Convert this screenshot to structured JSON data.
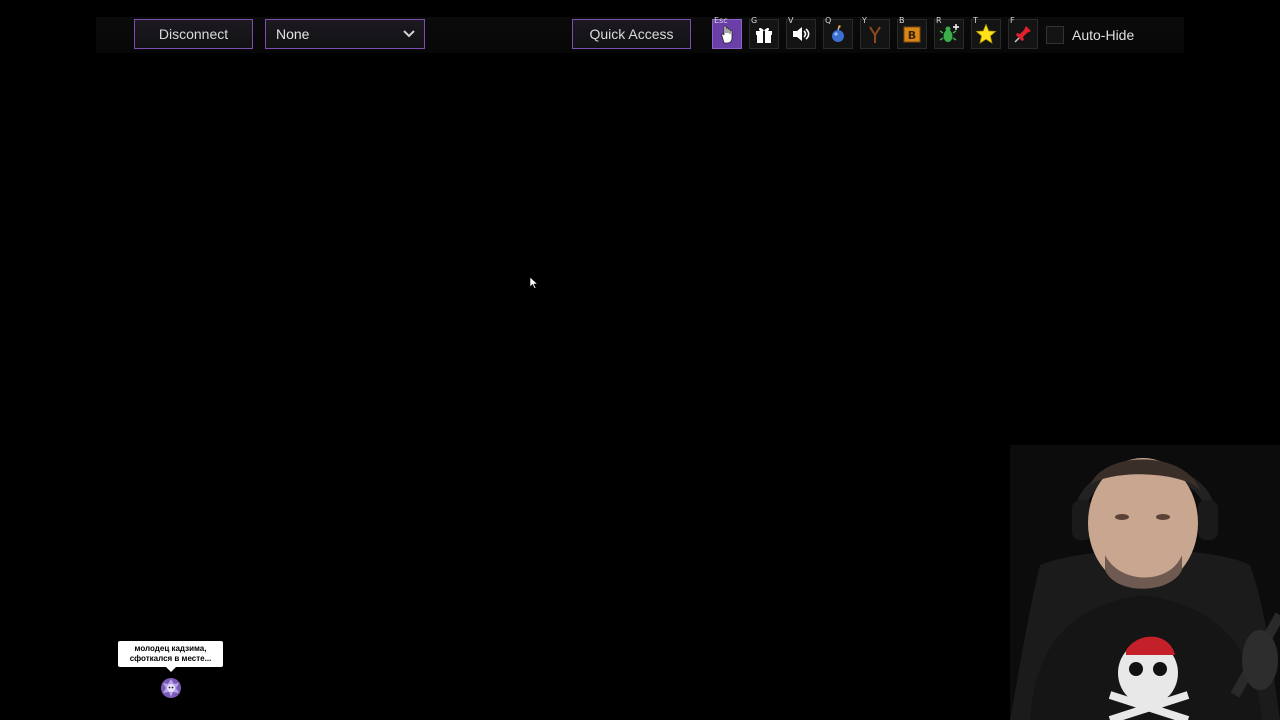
{
  "toolbar": {
    "disconnect_label": "Disconnect",
    "select_value": "None",
    "quick_access_label": "Quick Access",
    "tools": [
      {
        "key": "Esc",
        "icon": "hand-pointer-icon",
        "active": true
      },
      {
        "key": "G",
        "icon": "gift-icon",
        "active": false
      },
      {
        "key": "V",
        "icon": "speaker-icon",
        "active": false
      },
      {
        "key": "Q",
        "icon": "bomb-icon",
        "active": false
      },
      {
        "key": "Y",
        "icon": "slingshot-icon",
        "active": false
      },
      {
        "key": "B",
        "icon": "b-block-icon",
        "active": false
      },
      {
        "key": "R",
        "icon": "green-bug-icon",
        "active": false
      },
      {
        "key": "T",
        "icon": "star-icon",
        "active": false
      },
      {
        "key": "F",
        "icon": "pin-icon",
        "active": false
      }
    ],
    "autohide_label": "Auto-Hide",
    "autohide_checked": false
  },
  "chat_bubble": {
    "line1": "молодец кадзима,",
    "line2": "сфоткался в месте..."
  },
  "colors": {
    "accent": "#7b4fb0",
    "active_tool": "#6b3fa8",
    "background": "#000000"
  }
}
